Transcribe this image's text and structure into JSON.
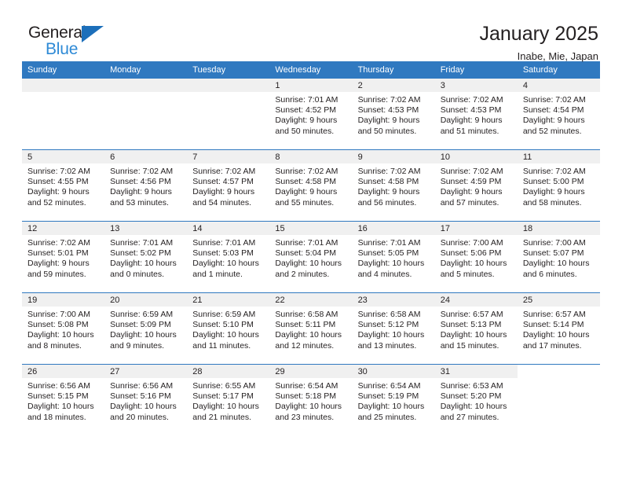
{
  "brand": {
    "name_part1": "General",
    "name_part2": "Blue",
    "accent_color": "#2e8ad6",
    "triangle_color": "#1c6fba"
  },
  "header": {
    "title": "January 2025",
    "location": "Inabe, Mie, Japan"
  },
  "calendar": {
    "header_bg": "#3079c0",
    "daynum_bg": "#f0f0f0",
    "weekdays": [
      "Sunday",
      "Monday",
      "Tuesday",
      "Wednesday",
      "Thursday",
      "Friday",
      "Saturday"
    ],
    "weeks": [
      [
        {
          "day": "",
          "empty": true
        },
        {
          "day": "",
          "empty": true
        },
        {
          "day": "",
          "empty": true
        },
        {
          "day": "1",
          "sunrise": "Sunrise: 7:01 AM",
          "sunset": "Sunset: 4:52 PM",
          "daylight_line1": "Daylight: 9 hours",
          "daylight_line2": "and 50 minutes."
        },
        {
          "day": "2",
          "sunrise": "Sunrise: 7:02 AM",
          "sunset": "Sunset: 4:53 PM",
          "daylight_line1": "Daylight: 9 hours",
          "daylight_line2": "and 50 minutes."
        },
        {
          "day": "3",
          "sunrise": "Sunrise: 7:02 AM",
          "sunset": "Sunset: 4:53 PM",
          "daylight_line1": "Daylight: 9 hours",
          "daylight_line2": "and 51 minutes."
        },
        {
          "day": "4",
          "sunrise": "Sunrise: 7:02 AM",
          "sunset": "Sunset: 4:54 PM",
          "daylight_line1": "Daylight: 9 hours",
          "daylight_line2": "and 52 minutes."
        }
      ],
      [
        {
          "day": "5",
          "sunrise": "Sunrise: 7:02 AM",
          "sunset": "Sunset: 4:55 PM",
          "daylight_line1": "Daylight: 9 hours",
          "daylight_line2": "and 52 minutes."
        },
        {
          "day": "6",
          "sunrise": "Sunrise: 7:02 AM",
          "sunset": "Sunset: 4:56 PM",
          "daylight_line1": "Daylight: 9 hours",
          "daylight_line2": "and 53 minutes."
        },
        {
          "day": "7",
          "sunrise": "Sunrise: 7:02 AM",
          "sunset": "Sunset: 4:57 PM",
          "daylight_line1": "Daylight: 9 hours",
          "daylight_line2": "and 54 minutes."
        },
        {
          "day": "8",
          "sunrise": "Sunrise: 7:02 AM",
          "sunset": "Sunset: 4:58 PM",
          "daylight_line1": "Daylight: 9 hours",
          "daylight_line2": "and 55 minutes."
        },
        {
          "day": "9",
          "sunrise": "Sunrise: 7:02 AM",
          "sunset": "Sunset: 4:58 PM",
          "daylight_line1": "Daylight: 9 hours",
          "daylight_line2": "and 56 minutes."
        },
        {
          "day": "10",
          "sunrise": "Sunrise: 7:02 AM",
          "sunset": "Sunset: 4:59 PM",
          "daylight_line1": "Daylight: 9 hours",
          "daylight_line2": "and 57 minutes."
        },
        {
          "day": "11",
          "sunrise": "Sunrise: 7:02 AM",
          "sunset": "Sunset: 5:00 PM",
          "daylight_line1": "Daylight: 9 hours",
          "daylight_line2": "and 58 minutes."
        }
      ],
      [
        {
          "day": "12",
          "sunrise": "Sunrise: 7:02 AM",
          "sunset": "Sunset: 5:01 PM",
          "daylight_line1": "Daylight: 9 hours",
          "daylight_line2": "and 59 minutes."
        },
        {
          "day": "13",
          "sunrise": "Sunrise: 7:01 AM",
          "sunset": "Sunset: 5:02 PM",
          "daylight_line1": "Daylight: 10 hours",
          "daylight_line2": "and 0 minutes."
        },
        {
          "day": "14",
          "sunrise": "Sunrise: 7:01 AM",
          "sunset": "Sunset: 5:03 PM",
          "daylight_line1": "Daylight: 10 hours",
          "daylight_line2": "and 1 minute."
        },
        {
          "day": "15",
          "sunrise": "Sunrise: 7:01 AM",
          "sunset": "Sunset: 5:04 PM",
          "daylight_line1": "Daylight: 10 hours",
          "daylight_line2": "and 2 minutes."
        },
        {
          "day": "16",
          "sunrise": "Sunrise: 7:01 AM",
          "sunset": "Sunset: 5:05 PM",
          "daylight_line1": "Daylight: 10 hours",
          "daylight_line2": "and 4 minutes."
        },
        {
          "day": "17",
          "sunrise": "Sunrise: 7:00 AM",
          "sunset": "Sunset: 5:06 PM",
          "daylight_line1": "Daylight: 10 hours",
          "daylight_line2": "and 5 minutes."
        },
        {
          "day": "18",
          "sunrise": "Sunrise: 7:00 AM",
          "sunset": "Sunset: 5:07 PM",
          "daylight_line1": "Daylight: 10 hours",
          "daylight_line2": "and 6 minutes."
        }
      ],
      [
        {
          "day": "19",
          "sunrise": "Sunrise: 7:00 AM",
          "sunset": "Sunset: 5:08 PM",
          "daylight_line1": "Daylight: 10 hours",
          "daylight_line2": "and 8 minutes."
        },
        {
          "day": "20",
          "sunrise": "Sunrise: 6:59 AM",
          "sunset": "Sunset: 5:09 PM",
          "daylight_line1": "Daylight: 10 hours",
          "daylight_line2": "and 9 minutes."
        },
        {
          "day": "21",
          "sunrise": "Sunrise: 6:59 AM",
          "sunset": "Sunset: 5:10 PM",
          "daylight_line1": "Daylight: 10 hours",
          "daylight_line2": "and 11 minutes."
        },
        {
          "day": "22",
          "sunrise": "Sunrise: 6:58 AM",
          "sunset": "Sunset: 5:11 PM",
          "daylight_line1": "Daylight: 10 hours",
          "daylight_line2": "and 12 minutes."
        },
        {
          "day": "23",
          "sunrise": "Sunrise: 6:58 AM",
          "sunset": "Sunset: 5:12 PM",
          "daylight_line1": "Daylight: 10 hours",
          "daylight_line2": "and 13 minutes."
        },
        {
          "day": "24",
          "sunrise": "Sunrise: 6:57 AM",
          "sunset": "Sunset: 5:13 PM",
          "daylight_line1": "Daylight: 10 hours",
          "daylight_line2": "and 15 minutes."
        },
        {
          "day": "25",
          "sunrise": "Sunrise: 6:57 AM",
          "sunset": "Sunset: 5:14 PM",
          "daylight_line1": "Daylight: 10 hours",
          "daylight_line2": "and 17 minutes."
        }
      ],
      [
        {
          "day": "26",
          "sunrise": "Sunrise: 6:56 AM",
          "sunset": "Sunset: 5:15 PM",
          "daylight_line1": "Daylight: 10 hours",
          "daylight_line2": "and 18 minutes."
        },
        {
          "day": "27",
          "sunrise": "Sunrise: 6:56 AM",
          "sunset": "Sunset: 5:16 PM",
          "daylight_line1": "Daylight: 10 hours",
          "daylight_line2": "and 20 minutes."
        },
        {
          "day": "28",
          "sunrise": "Sunrise: 6:55 AM",
          "sunset": "Sunset: 5:17 PM",
          "daylight_line1": "Daylight: 10 hours",
          "daylight_line2": "and 21 minutes."
        },
        {
          "day": "29",
          "sunrise": "Sunrise: 6:54 AM",
          "sunset": "Sunset: 5:18 PM",
          "daylight_line1": "Daylight: 10 hours",
          "daylight_line2": "and 23 minutes."
        },
        {
          "day": "30",
          "sunrise": "Sunrise: 6:54 AM",
          "sunset": "Sunset: 5:19 PM",
          "daylight_line1": "Daylight: 10 hours",
          "daylight_line2": "and 25 minutes."
        },
        {
          "day": "31",
          "sunrise": "Sunrise: 6:53 AM",
          "sunset": "Sunset: 5:20 PM",
          "daylight_line1": "Daylight: 10 hours",
          "daylight_line2": "and 27 minutes."
        },
        {
          "day": "",
          "blank": true
        }
      ]
    ]
  }
}
